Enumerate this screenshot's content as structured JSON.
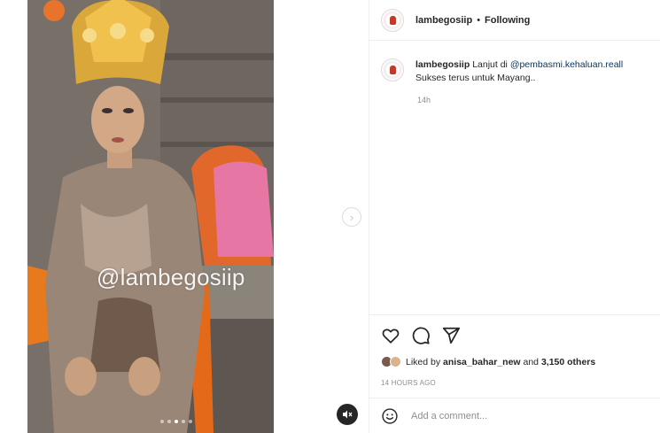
{
  "media": {
    "watermark": "@lambegosiip",
    "carousel_dots": 5,
    "active_dot": 3,
    "next_icon": "chevron-right-icon",
    "mute_icon": "speaker-muted-icon"
  },
  "post": {
    "username": "lambegosiip",
    "separator": "•",
    "follow_status": "Following"
  },
  "caption": {
    "username": "lambegosiip",
    "text_before": "Lanjut di ",
    "mention": "@pembasmi.kehaluan.reall",
    "line2": "Sukses terus untuk Mayang..",
    "time": "14h"
  },
  "actions": {
    "like_icon": "heart-icon",
    "comment_icon": "comment-icon",
    "share_icon": "send-icon"
  },
  "likes": {
    "prefix": "Liked by ",
    "user": "anisa_bahar_new",
    "middle": " and ",
    "others": "3,150 others"
  },
  "timestamp": "14 HOURS AGO",
  "comment": {
    "placeholder": "Add a comment...",
    "emoji_icon": "emoji-icon"
  },
  "colors": {
    "text": "#262626",
    "muted": "#8e8e8e",
    "link": "#00376b",
    "border": "#efefef"
  }
}
